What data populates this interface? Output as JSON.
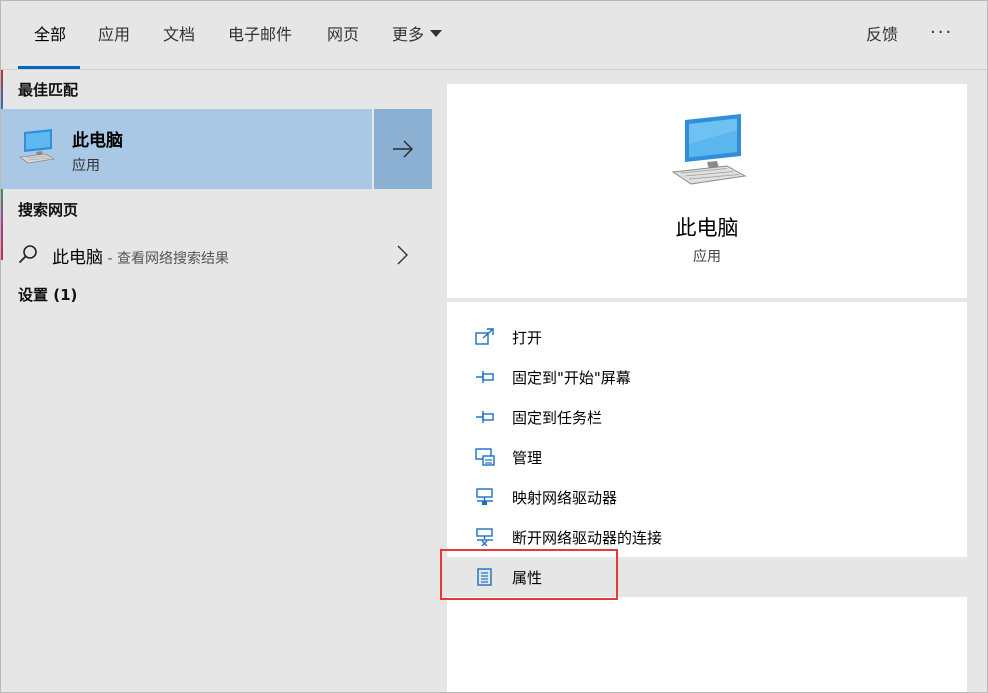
{
  "tabs": [
    {
      "label": "全部",
      "active": true
    },
    {
      "label": "应用"
    },
    {
      "label": "文档"
    },
    {
      "label": "电子邮件"
    },
    {
      "label": "网页"
    },
    {
      "label": "更多"
    }
  ],
  "feedback_label": "反馈",
  "more_dots": "···",
  "left": {
    "best_match_title": "最佳匹配",
    "best_match": {
      "name": "此电脑",
      "type": "应用",
      "icon": "computer-icon"
    },
    "web_title": "搜索网页",
    "web_result": {
      "query": "此电脑",
      "suffix": " - 查看网络搜索结果"
    },
    "settings_title": "设置 (1)"
  },
  "detail": {
    "name": "此电脑",
    "type": "应用",
    "actions": [
      {
        "label": "打开",
        "icon": "open-icon"
      },
      {
        "label": "固定到\"开始\"屏幕",
        "icon": "pin-icon"
      },
      {
        "label": "固定到任务栏",
        "icon": "pin-icon"
      },
      {
        "label": "管理",
        "icon": "manage-icon"
      },
      {
        "label": "映射网络驱动器",
        "icon": "map-drive-icon"
      },
      {
        "label": "断开网络驱动器的连接",
        "icon": "disconnect-drive-icon"
      },
      {
        "label": "属性",
        "icon": "properties-icon",
        "hovered": true
      }
    ]
  },
  "colors": {
    "accent": "#0067c0",
    "selected_bg": "#a8c8e6",
    "highlight": "#e33b3b"
  }
}
